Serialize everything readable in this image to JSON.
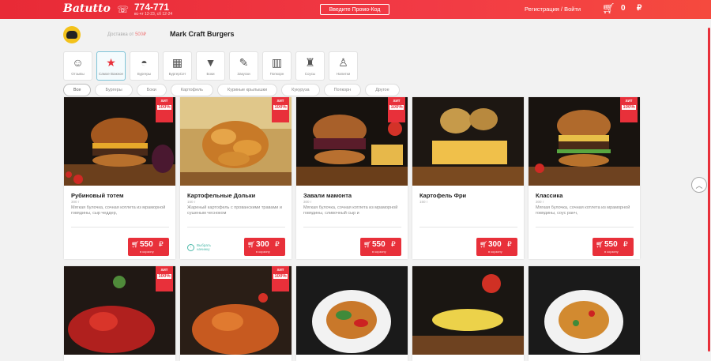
{
  "header": {
    "logo": "Batutto",
    "phone": "774-771",
    "hours": "вс-чт 12-23, сб 12-24",
    "promo_label": "Введите Промо-Код",
    "auth_label": "Регистрация / Войти",
    "cart_count": "0",
    "currency": "₽"
  },
  "restaurant": {
    "delivery_prefix": "Доставка от",
    "delivery_amount": "500₽",
    "name": "Mark Craft Burgers"
  },
  "categories": [
    {
      "label": "Отзывы",
      "icon": "review-icon"
    },
    {
      "label": "Самое Важное",
      "icon": "star-icon"
    },
    {
      "label": "Бургеры",
      "icon": "burger-icon"
    },
    {
      "label": "БургерСет",
      "icon": "burger-set-icon"
    },
    {
      "label": "Боки",
      "icon": "cup-icon"
    },
    {
      "label": "Закуски",
      "icon": "snacks-icon"
    },
    {
      "label": "Попкорн",
      "icon": "popcorn-icon"
    },
    {
      "label": "Соусы",
      "icon": "sauce-icon"
    },
    {
      "label": "Напитки",
      "icon": "drink-icon"
    }
  ],
  "filters": [
    "Все",
    "Бургеры",
    "Боки",
    "Картофель",
    "Куриные крылышки",
    "Кукуруза",
    "Попкорн",
    "Другое"
  ],
  "badge": {
    "top": "ХИТ",
    "pct": "100%"
  },
  "products": [
    {
      "name": "Рубиновый тотем",
      "weight": "300 г",
      "desc": "Мягкая булочка, сочная котлета из мраморной говядины, сыр чеддер,",
      "price": "550",
      "action": "в корзину"
    },
    {
      "name": "Картофельные Дольки",
      "weight": "150 г",
      "desc": "Жареный картофель с прованскими травами и сушеным чесноком",
      "price": "300",
      "action": "в корзину",
      "choose": "Выбрать начинку"
    },
    {
      "name": "Завали мамонта",
      "weight": "300 г",
      "desc": "Мягкая булочка, сочная котлета из мраморной говядины, сливочный сыр и",
      "price": "550",
      "action": "в корзину"
    },
    {
      "name": "Картофель Фри",
      "weight": "150 г",
      "desc": "",
      "price": "300",
      "action": "в корзину"
    },
    {
      "name": "Классика",
      "weight": "300 г",
      "desc": "Мягкая булочка, сочная котлета из мраморной говядины, соус ранч,",
      "price": "550",
      "action": "в корзину"
    }
  ],
  "colors": {
    "accent": "#e8303a",
    "teal": "#4ab8a8"
  }
}
